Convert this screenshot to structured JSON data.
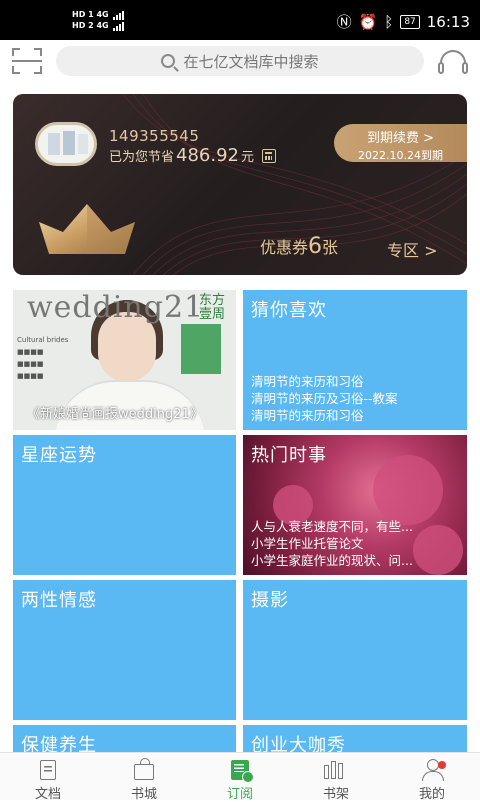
{
  "status": {
    "left_top": "HD 1  4G",
    "left_bottom": "HD 2  4G",
    "icons": [
      "nfc-icon",
      "alarm-icon",
      "bluetooth-icon"
    ],
    "battery": "87",
    "time": "16:13"
  },
  "search": {
    "placeholder": "在七亿文档库中搜索"
  },
  "vip": {
    "user_id": "149355545",
    "save_prefix": "已为您节省",
    "save_amount": "486.92",
    "save_unit": "元",
    "renew_label": "到期续费 >",
    "expire_text": "2022.10.24到期",
    "coupon_prefix": "优惠券",
    "coupon_count": "6",
    "coupon_suffix": "张",
    "zone_label": "专区 >"
  },
  "tiles": [
    {
      "kind": "photo",
      "masthead": "wedding21",
      "masthead_side": "东方\n壹周",
      "caption": "《新娘婚尚画报wedding21》"
    },
    {
      "title": "猜你喜欢",
      "lines": [
        "清明节的来历和习俗",
        "清明节的来历及习俗--教案",
        "清明节的来历和习俗"
      ]
    },
    {
      "title": "星座运势",
      "lines": []
    },
    {
      "title": "热门时事",
      "lines": [
        "人与人衰老速度不同，有些...",
        "小学生作业托管论文",
        "小学生家庭作业的现状、问..."
      ]
    },
    {
      "title": "两性情感",
      "lines": []
    },
    {
      "title": "摄影",
      "lines": []
    },
    {
      "title": "保健养生",
      "lines": []
    },
    {
      "title": "创业大咖秀",
      "lines": []
    }
  ],
  "tabs": [
    {
      "label": "文档",
      "icon": "document-icon",
      "active": false
    },
    {
      "label": "书城",
      "icon": "shopping-bag-icon",
      "active": false
    },
    {
      "label": "订阅",
      "icon": "subscribe-icon",
      "active": true
    },
    {
      "label": "书架",
      "icon": "bookshelf-icon",
      "active": false
    },
    {
      "label": "我的",
      "icon": "profile-icon",
      "active": false
    }
  ],
  "colors": {
    "tile_blue": "#5ab8f2",
    "vip_gold": "#e6c79a",
    "tab_active": "#3aa84f",
    "notification_dot": "#e53935"
  }
}
